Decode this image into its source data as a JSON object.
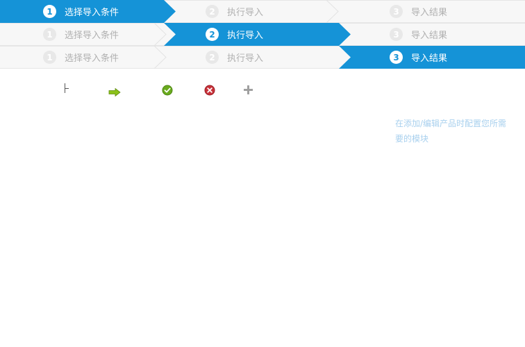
{
  "colors": {
    "active": "#1593d7",
    "inactive_bg": "#f7f7f7",
    "inactive_text": "#b0b0b0",
    "hint_text": "#a8d0ee"
  },
  "steps": [
    {
      "number": "1",
      "label": "选择导入条件"
    },
    {
      "number": "2",
      "label": "执行导入"
    },
    {
      "number": "3",
      "label": "导入结果"
    }
  ],
  "stepbars": [
    {
      "active_step": 1
    },
    {
      "active_step": 2
    },
    {
      "active_step": 3
    }
  ],
  "icons": [
    {
      "name": "tree-line-icon"
    },
    {
      "name": "arrow-right-icon",
      "color": "#8cc21a"
    },
    {
      "name": "check-circle-icon",
      "color": "#6aab1e"
    },
    {
      "name": "close-circle-icon",
      "color": "#c8323a"
    },
    {
      "name": "plus-icon",
      "color": "#a0a0a0"
    }
  ],
  "hint": {
    "text": "在添加/编辑产品时配置您所需要的模块"
  }
}
